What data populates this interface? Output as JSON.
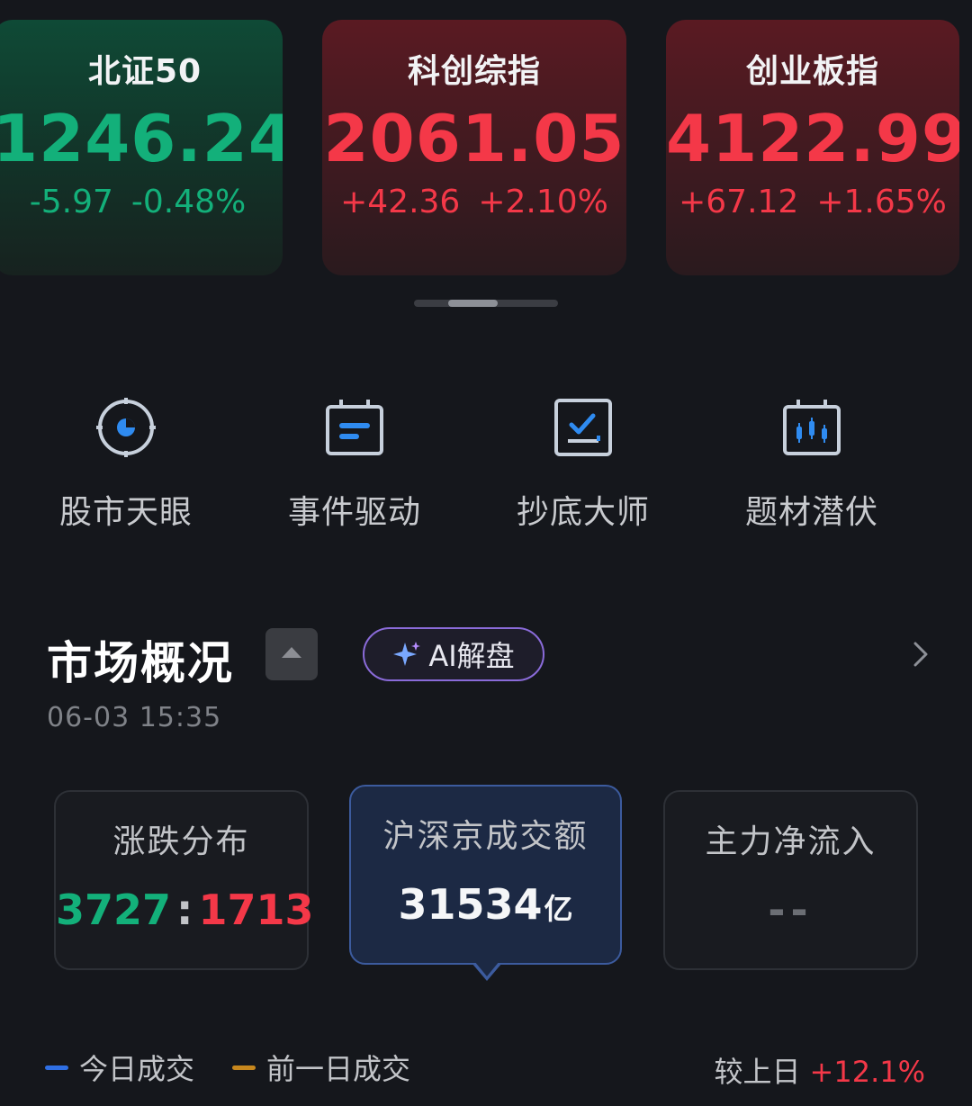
{
  "indices": [
    {
      "name": "北证50",
      "value": "1246.24",
      "change": "-5.97",
      "pct": "-0.48%",
      "trend": "down",
      "color": "#13b07a"
    },
    {
      "name": "科创综指",
      "value": "2061.05",
      "change": "+42.36",
      "pct": "+2.10%",
      "trend": "up",
      "color": "#f43848"
    },
    {
      "name": "创业板指",
      "value": "4122.99",
      "change": "+67.12",
      "pct": "+1.65%",
      "trend": "up",
      "color": "#f43848"
    }
  ],
  "tools": [
    {
      "label": "股市天眼",
      "icon": "radar-icon"
    },
    {
      "label": "事件驱动",
      "icon": "calendar-event-icon"
    },
    {
      "label": "抄底大师",
      "icon": "chart-check-icon"
    },
    {
      "label": "题材潜伏",
      "icon": "candlestick-icon"
    }
  ],
  "market": {
    "title": "市场概况",
    "ai_label": "AI解盘",
    "timestamp": "06-03 15:35",
    "cards": {
      "distribution": {
        "title": "涨跌分布",
        "up_count": "3727",
        "separator": ":",
        "down_count": "1713"
      },
      "turnover": {
        "title": "沪深京成交额",
        "value": "31534",
        "unit": "亿"
      },
      "net_inflow": {
        "title": "主力净流入",
        "value": "--"
      }
    },
    "legend": {
      "today": "今日成交",
      "yesterday": "前一日成交",
      "today_color": "#2f6fe4",
      "yesterday_color": "#c7871d"
    },
    "compare": {
      "label": "较上日",
      "value": "+12.1%"
    }
  },
  "colors": {
    "up_red": "#f43848",
    "down_green": "#13b07a",
    "background": "#15171c"
  }
}
